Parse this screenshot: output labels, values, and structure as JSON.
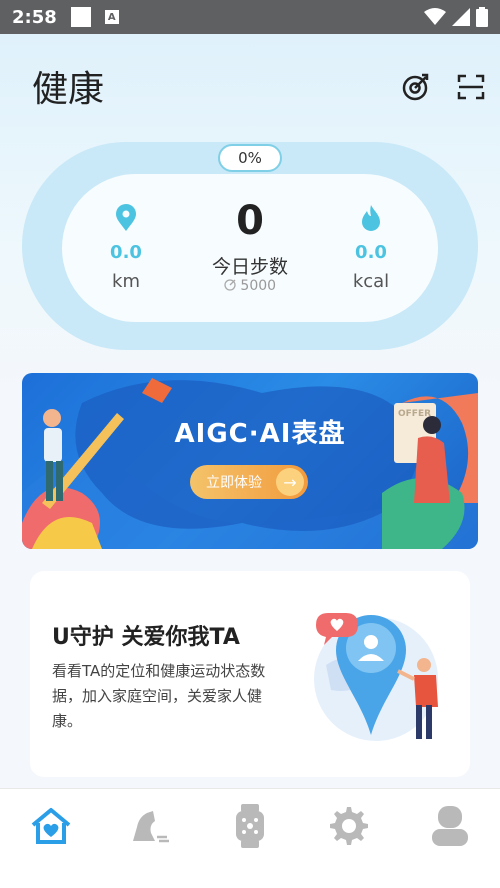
{
  "status_bar": {
    "time": "2:58",
    "a_icon_letter": "A"
  },
  "header": {
    "title": "健康"
  },
  "step_ring": {
    "progress_label": "0%",
    "distance_value": "0.0",
    "distance_unit": "km",
    "steps_value": "0",
    "steps_label": "今日步数",
    "steps_goal": "5000",
    "calories_value": "0.0",
    "calories_unit": "kcal"
  },
  "banner": {
    "title": "AIGC·AI表盘",
    "button_label": "立即体验",
    "sign_text": "OFFER"
  },
  "guard_card": {
    "title": "U守护 关爱你我TA",
    "description": "看看TA的定位和健康运动状态数据，加入家庭空间，关爱家人健康。"
  },
  "tabs": [
    {
      "icon": "home-heart-icon",
      "active": true
    },
    {
      "icon": "sneaker-icon",
      "active": false
    },
    {
      "icon": "watch-icon",
      "active": false
    },
    {
      "icon": "gear-icon",
      "active": false
    },
    {
      "icon": "profile-icon",
      "active": false
    }
  ],
  "colors": {
    "accent": "#4cc3e0",
    "active_tab": "#2b9ee8",
    "inactive_tab": "#b9b9b9"
  }
}
